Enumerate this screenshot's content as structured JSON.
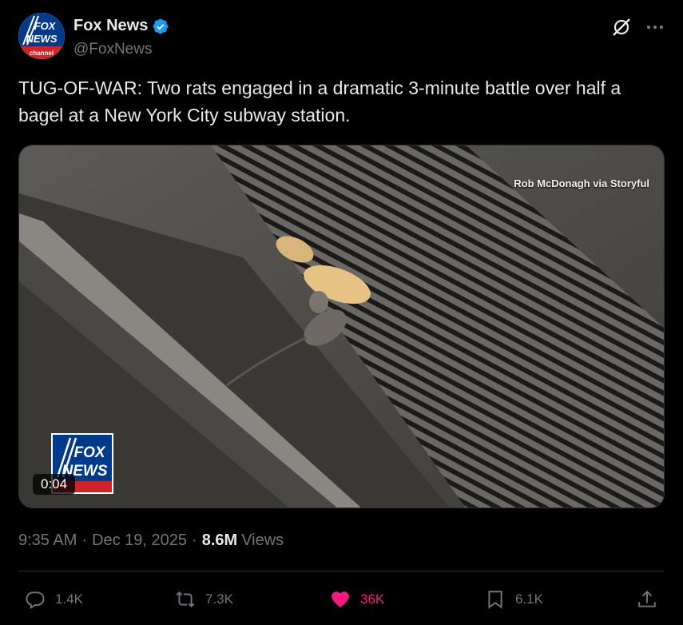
{
  "post": {
    "author_name": "Fox News",
    "handle": "@FoxNews",
    "avatar_text_top": "FOX",
    "avatar_text_mid": "NEWS",
    "avatar_text_bottom": "channel",
    "text": "TUG-OF-WAR: Two rats engaged in a dramatic 3-minute battle over half a bagel at a New York City subway station.",
    "media": {
      "credit": "Rob McDonagh via Storyful",
      "timer": "0:04",
      "watermark_top": "FOX",
      "watermark_bottom": "NEWS"
    },
    "time": "9:35 AM",
    "separator": "·",
    "date": "Dec 19, 2025",
    "views_count": "8.6M",
    "views_label": "Views"
  },
  "actions": {
    "replies": "1.4K",
    "reposts": "7.3K",
    "likes": "36K",
    "bookmarks": "6.1K"
  },
  "icons": [
    "verified-badge-icon",
    "grok-icon",
    "more-icon",
    "reply-icon",
    "repost-icon",
    "like-icon",
    "bookmark-icon",
    "share-icon"
  ],
  "colors": {
    "background": "#000000",
    "text": "#e7e9ea",
    "secondary": "#71767b",
    "verified": "#1d9bf0",
    "like": "#f91880",
    "fox_blue": "#003a8c",
    "fox_red": "#d2232a"
  }
}
